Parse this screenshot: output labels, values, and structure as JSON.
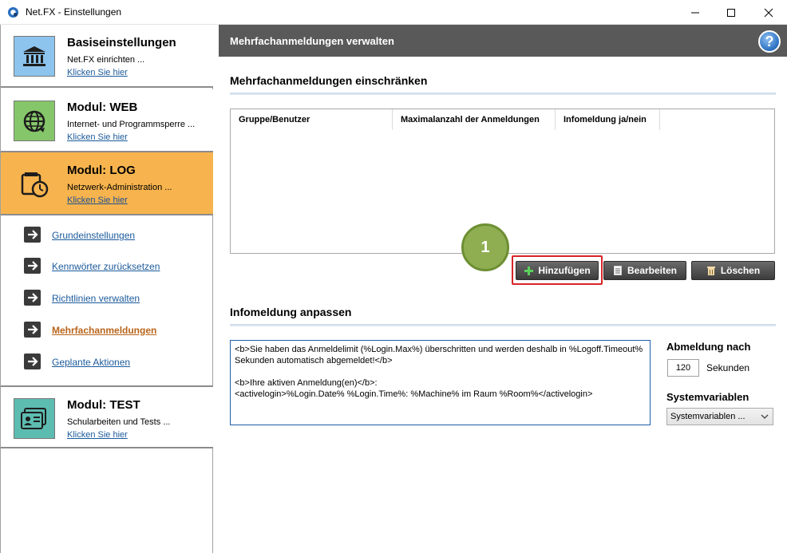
{
  "window": {
    "title": "Net.FX - Einstellungen"
  },
  "sidebar": {
    "modules": [
      {
        "title": "Basiseinstellungen",
        "subtitle": "Net.FX einrichten ...",
        "link": "Klicken Sie hier",
        "icon": "bank-icon"
      },
      {
        "title": "Modul: WEB",
        "subtitle": "Internet- und Programmsperre ...",
        "link": "Klicken Sie hier",
        "icon": "globe-icon"
      },
      {
        "title": "Modul: LOG",
        "subtitle": "Netzwerk-Administration ...",
        "link": "Klicken Sie hier",
        "icon": "wallet-clock-icon"
      },
      {
        "title": "Modul: TEST",
        "subtitle": "Schularbeiten und Tests ...",
        "link": "Klicken Sie hier",
        "icon": "id-card-icon"
      }
    ],
    "nav_items": [
      {
        "label": "Grundeinstellungen"
      },
      {
        "label": "Kennwörter zurücksetzen"
      },
      {
        "label": "Richtlinien verwalten"
      },
      {
        "label": "Mehrfachanmeldungen"
      },
      {
        "label": "Geplante Aktionen"
      }
    ]
  },
  "main": {
    "header_title": "Mehrfachanmeldungen verwalten",
    "help": "?",
    "section1_title": "Mehrfachanmeldungen einschränken",
    "table": {
      "columns": [
        "Gruppe/Benutzer",
        "Maximalanzahl der Anmeldungen",
        "Infomeldung ja/nein"
      ]
    },
    "buttons": {
      "add": "Hinzufügen",
      "edit": "Bearbeiten",
      "delete": "Löschen"
    },
    "badge": "1",
    "section2_title": "Infomeldung anpassen",
    "message_text": "<b>Sie haben das Anmeldelimit (%Login.Max%) überschritten und werden deshalb in %Logoff.Timeout% Sekunden automatisch abgemeldet!</b>\n\n<b>Ihre aktiven Anmeldung(en)</b>:\n<activelogin>%Login.Date% %Login.Time%: %Machine% im Raum %Room%</activelogin>",
    "logout_label": "Abmeldung nach",
    "logout_value": "120",
    "logout_unit": "Sekunden",
    "sysvar_label": "Systemvariablen",
    "sysvar_select": "Systemvariablen ..."
  },
  "colors": {
    "active_module": "#f7b44e",
    "header": "#595959",
    "highlight": "#d7252a",
    "badge": "#8fae52",
    "link": "#1b5a9b"
  }
}
